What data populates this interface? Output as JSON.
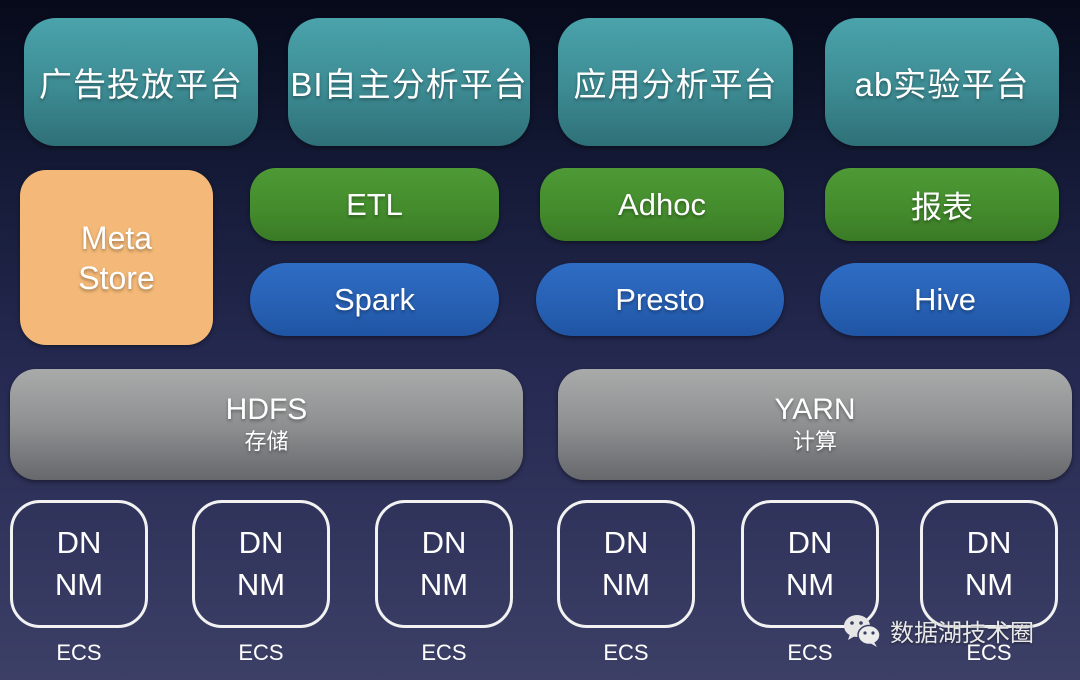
{
  "applications": [
    {
      "label": "广告投放平台"
    },
    {
      "label": "BI自主分析平台"
    },
    {
      "label": "应用分析平台"
    },
    {
      "label": "ab实验平台"
    }
  ],
  "metastore": {
    "line1": "Meta",
    "line2": "Store"
  },
  "tools": [
    {
      "label": "ETL"
    },
    {
      "label": "Adhoc"
    },
    {
      "label": "报表"
    }
  ],
  "engines": [
    {
      "label": "Spark"
    },
    {
      "label": "Presto"
    },
    {
      "label": "Hive"
    }
  ],
  "infrastructure": [
    {
      "title": "HDFS",
      "subtitle": "存储"
    },
    {
      "title": "YARN",
      "subtitle": "计算"
    }
  ],
  "nodes": [
    {
      "line1": "DN",
      "line2": "NM",
      "label": "ECS"
    },
    {
      "line1": "DN",
      "line2": "NM",
      "label": "ECS"
    },
    {
      "line1": "DN",
      "line2": "NM",
      "label": "ECS"
    },
    {
      "line1": "DN",
      "line2": "NM",
      "label": "ECS"
    },
    {
      "line1": "DN",
      "line2": "NM",
      "label": "ECS"
    },
    {
      "line1": "DN",
      "line2": "NM",
      "label": "ECS"
    }
  ],
  "watermark": {
    "icon": "wechat-icon",
    "text": "数据湖技术圈"
  },
  "colors": {
    "application": "#3d8b93",
    "metastore": "#f4b978",
    "tool": "#438b2c",
    "engine": "#2760b3",
    "infrastructure": "#8e9091"
  }
}
